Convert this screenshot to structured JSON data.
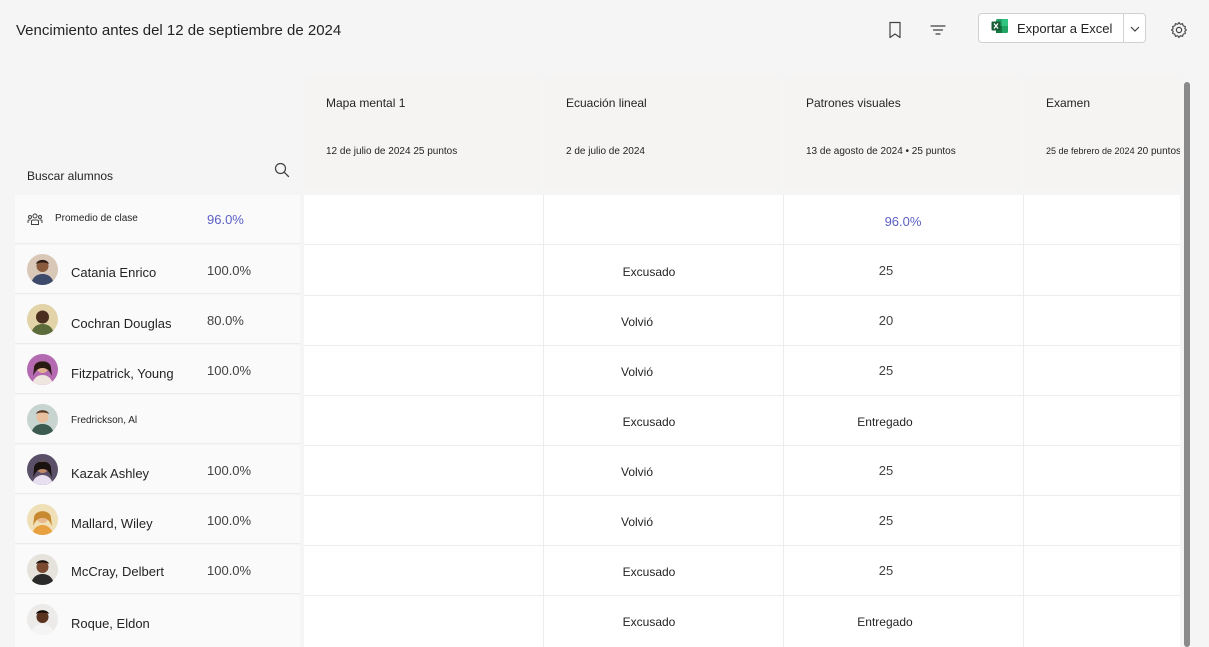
{
  "header": {
    "title": "Vencimiento antes del 12 de septiembre de 2024",
    "export_label": "Exportar a Excel",
    "icons": [
      "bookmark-icon",
      "filter-icon",
      "excel-icon",
      "chevron-down-icon",
      "gear-icon"
    ]
  },
  "search": {
    "label": "Buscar alumnos"
  },
  "class_average": {
    "label": "Promedio de clase",
    "value": "96.0%",
    "color": "#5b5fc7"
  },
  "assignments": [
    {
      "name": "Mapa mental 1",
      "date": "12 de julio de 2024",
      "points": "25 puntos",
      "average": ""
    },
    {
      "name": "Ecuación lineal",
      "date": "2 de julio de 2024",
      "points": "",
      "average": ""
    },
    {
      "name": "Patrones visuales",
      "date": "13 de agosto de 2024 • 25 puntos",
      "points": "",
      "average": "96.0%"
    },
    {
      "name": "Examen",
      "date": "25 de febrero de 2024",
      "points": "20 puntos",
      "average": ""
    }
  ],
  "students": [
    {
      "name": "Catania Enrico",
      "pct": "100.0%",
      "grades": [
        "",
        "Excusado",
        "25",
        ""
      ]
    },
    {
      "name": "Cochran Douglas",
      "pct": "80.0%",
      "grades": [
        "",
        "Volvió",
        "20",
        ""
      ]
    },
    {
      "name": "Fitzpatrick, Young",
      "pct": "100.0%",
      "grades": [
        "",
        "Volvió",
        "25",
        ""
      ]
    },
    {
      "name": "Fredrickson, Al",
      "pct": "",
      "grades": [
        "",
        "Excusado",
        "Entregado",
        ""
      ]
    },
    {
      "name": "Kazak Ashley",
      "pct": "100.0%",
      "grades": [
        "",
        "Volvió",
        "25",
        ""
      ]
    },
    {
      "name": "Mallard, Wiley",
      "pct": "100.0%",
      "grades": [
        "",
        "Volvió",
        "25",
        ""
      ]
    },
    {
      "name": "McCray, Delbert",
      "pct": "100.0%",
      "grades": [
        "",
        "Excusado",
        "25",
        ""
      ]
    },
    {
      "name": "Roque, Eldon",
      "pct": "",
      "grades": [
        "",
        "Excusado",
        "Entregado",
        ""
      ]
    }
  ]
}
